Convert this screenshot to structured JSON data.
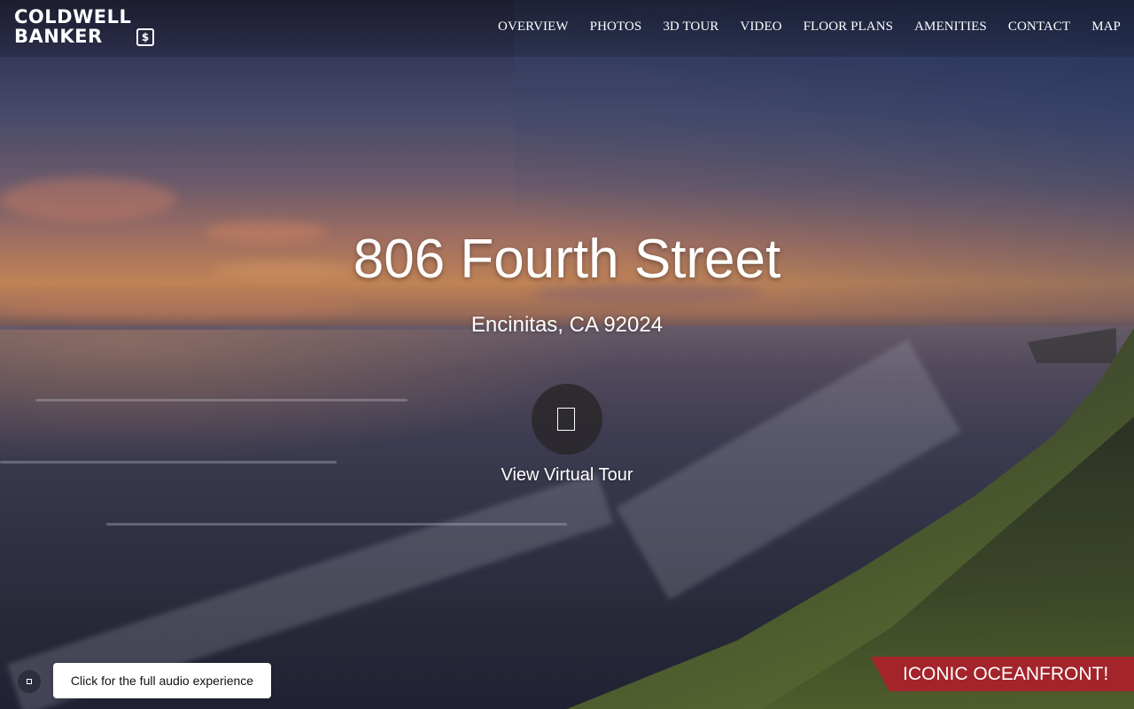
{
  "brand": {
    "logo_line1": "COLDWELL",
    "logo_line2": "BANKER",
    "logo_badge": "$"
  },
  "nav": {
    "items": [
      {
        "label": "OVERVIEW"
      },
      {
        "label": "PHOTOS"
      },
      {
        "label": "3D TOUR"
      },
      {
        "label": "VIDEO"
      },
      {
        "label": "FLOOR PLANS"
      },
      {
        "label": "AMENITIES"
      },
      {
        "label": "CONTACT"
      },
      {
        "label": "MAP"
      }
    ]
  },
  "hero": {
    "title": "806 Fourth Street",
    "subtitle": "Encinitas, CA 92024",
    "tour_icon": "tablet-icon",
    "tour_label": "View Virtual Tour"
  },
  "audio": {
    "icon": "speaker-icon",
    "prompt": "Click for the full audio experience"
  },
  "promo": {
    "text": "ICONIC OCEANFRONT!",
    "color": "#a3242b"
  }
}
